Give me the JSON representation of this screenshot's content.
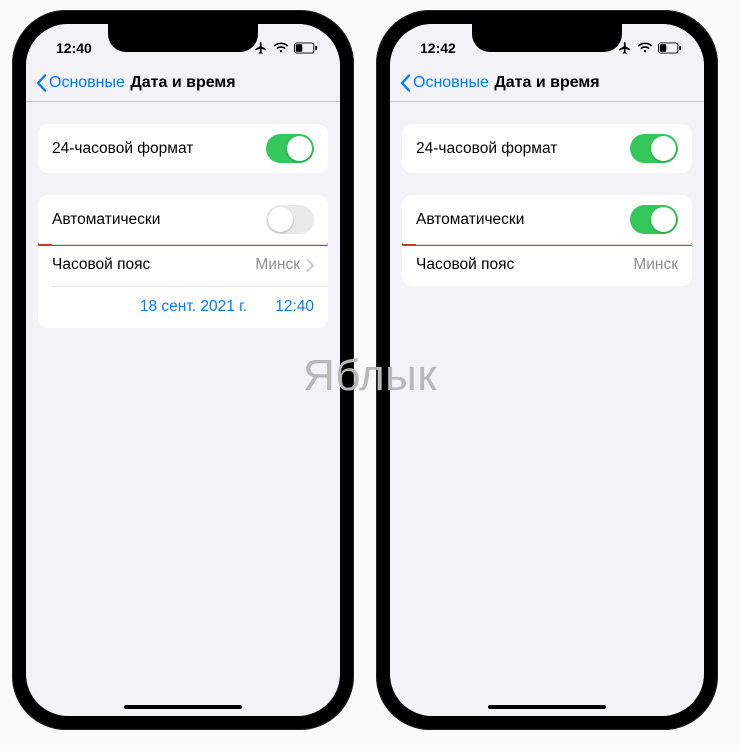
{
  "watermark": "Яблык",
  "phones": [
    {
      "time": "12:40",
      "back_label": "Основные",
      "title": "Дата и время",
      "row_24h_label": "24-часовой формат",
      "row_24h_on": true,
      "row_auto_label": "Автоматически",
      "row_auto_on": false,
      "row_tz_label": "Часовой пояс",
      "row_tz_value": "Минск",
      "show_tz_chevron": true,
      "show_datetime_row": true,
      "date_value": "18 сент. 2021 г.",
      "time_value": "12:40"
    },
    {
      "time": "12:42",
      "back_label": "Основные",
      "title": "Дата и время",
      "row_24h_label": "24-часовой формат",
      "row_24h_on": true,
      "row_auto_label": "Автоматически",
      "row_auto_on": true,
      "row_tz_label": "Часовой пояс",
      "row_tz_value": "Минск",
      "show_tz_chevron": false,
      "show_datetime_row": false,
      "date_value": "",
      "time_value": ""
    }
  ]
}
